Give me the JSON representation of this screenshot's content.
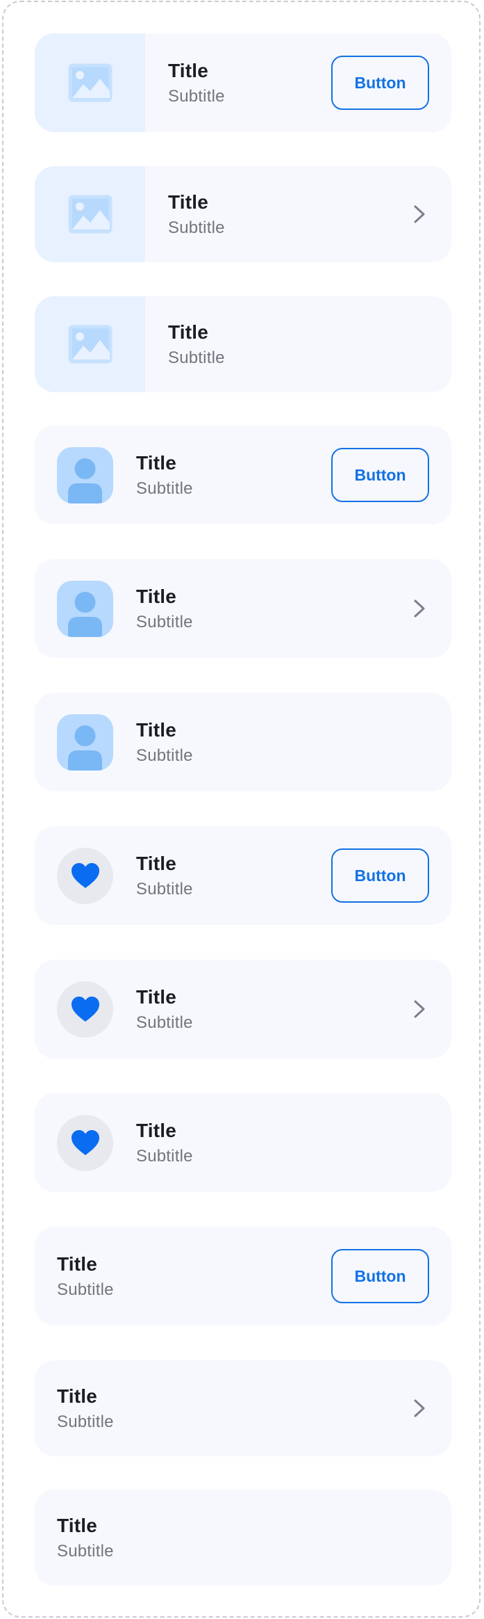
{
  "items": [
    {
      "type": "image",
      "action": "button",
      "title": "Title",
      "subtitle": "Subtitle",
      "button_label": "Button"
    },
    {
      "type": "image",
      "action": "chevron",
      "title": "Title",
      "subtitle": "Subtitle"
    },
    {
      "type": "image",
      "action": "none",
      "title": "Title",
      "subtitle": "Subtitle"
    },
    {
      "type": "avatar",
      "action": "button",
      "title": "Title",
      "subtitle": "Subtitle",
      "button_label": "Button"
    },
    {
      "type": "avatar",
      "action": "chevron",
      "title": "Title",
      "subtitle": "Subtitle"
    },
    {
      "type": "avatar",
      "action": "none",
      "title": "Title",
      "subtitle": "Subtitle"
    },
    {
      "type": "heart",
      "action": "button",
      "title": "Title",
      "subtitle": "Subtitle",
      "button_label": "Button"
    },
    {
      "type": "heart",
      "action": "chevron",
      "title": "Title",
      "subtitle": "Subtitle"
    },
    {
      "type": "heart",
      "action": "none",
      "title": "Title",
      "subtitle": "Subtitle"
    },
    {
      "type": "text",
      "action": "button",
      "title": "Title",
      "subtitle": "Subtitle",
      "button_label": "Button"
    },
    {
      "type": "text",
      "action": "chevron",
      "title": "Title",
      "subtitle": "Subtitle"
    },
    {
      "type": "text",
      "action": "none",
      "title": "Title",
      "subtitle": "Subtitle"
    }
  ],
  "icons": {
    "image": "image-placeholder-icon",
    "avatar": "user-avatar-icon",
    "heart": "heart-icon",
    "chevron": "chevron-right-icon"
  },
  "colors": {
    "accent": "#1271e6",
    "card_background": "#f6f8fd",
    "thumb_background": "#e8f1ff",
    "avatar_background": "#b6d9fd",
    "avatar_figure": "#7ab7f5",
    "heart": "#0a6cf0",
    "title_text": "#1b1d22",
    "subtitle_text": "#72757c"
  }
}
